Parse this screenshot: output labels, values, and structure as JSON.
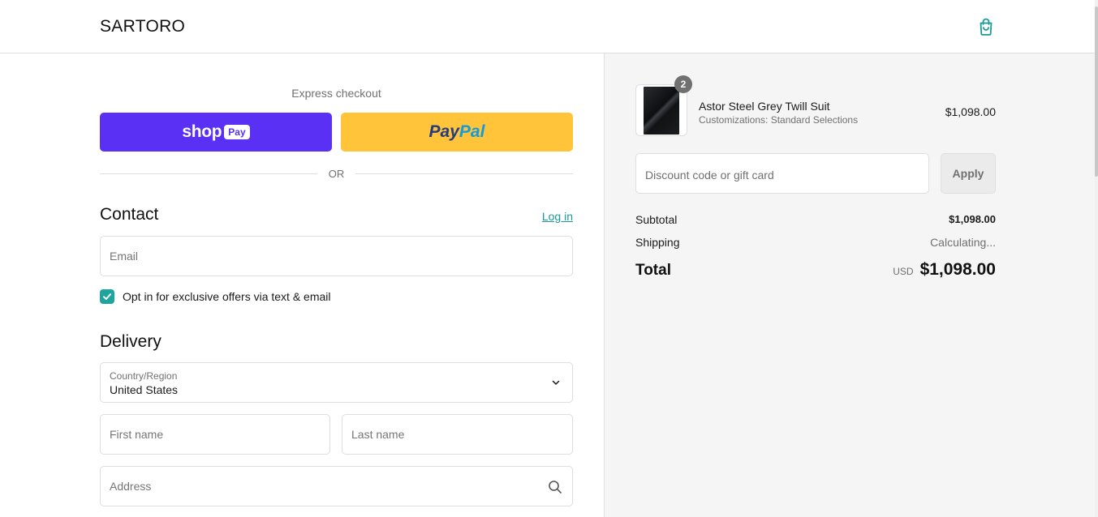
{
  "header": {
    "brand": "SARTORO",
    "cart_icon": "shopping-bag-icon"
  },
  "express": {
    "title": "Express checkout",
    "shop_pay": {
      "word": "shop",
      "badge": "Pay"
    },
    "paypal": {
      "part1": "Pay",
      "part2": "Pal"
    },
    "divider": "OR"
  },
  "contact": {
    "heading": "Contact",
    "login": "Log in",
    "email_placeholder": "Email",
    "optin_checked": true,
    "optin_label": "Opt in for exclusive offers via text & email"
  },
  "delivery": {
    "heading": "Delivery",
    "country_label": "Country/Region",
    "country_value": "United States",
    "first_name_placeholder": "First name",
    "last_name_placeholder": "Last name",
    "address_placeholder": "Address"
  },
  "summary": {
    "item": {
      "quantity": "2",
      "name": "Astor Steel Grey Twill Suit",
      "variant": "Customizations: Standard Selections",
      "price": "$1,098.00"
    },
    "discount_placeholder": "Discount code or gift card",
    "apply": "Apply",
    "subtotal_label": "Subtotal",
    "subtotal_value": "$1,098.00",
    "shipping_label": "Shipping",
    "shipping_value": "Calculating...",
    "total_label": "Total",
    "total_currency": "USD",
    "total_value": "$1,098.00"
  },
  "colors": {
    "accent": "#1fa59f",
    "shop_pay": "#5a31f4",
    "paypal": "#ffc439"
  }
}
